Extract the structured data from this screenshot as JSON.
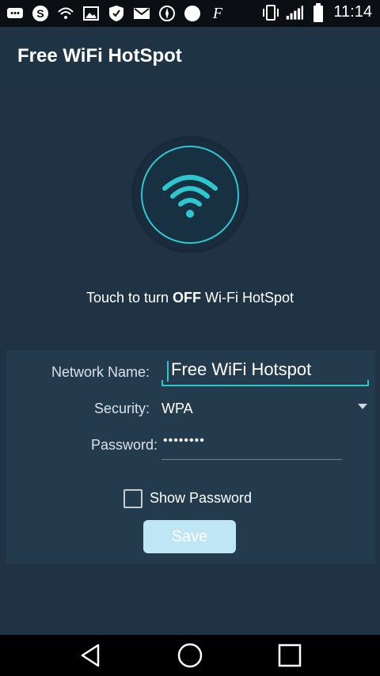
{
  "status_bar": {
    "time": "11:14",
    "icons": [
      "chat-icon",
      "skype-icon",
      "wifi-hotspot-icon",
      "image-icon",
      "shield-icon",
      "mail-icon",
      "compass-icon",
      "circle-icon",
      "f-letter-icon",
      "vibrate-icon",
      "signal-icon",
      "battery-icon"
    ],
    "f_glyph": "F"
  },
  "app_bar": {
    "title": "Free WiFi HotSpot"
  },
  "hotspot": {
    "instruction_prefix": "Touch to turn ",
    "instruction_state": "OFF",
    "instruction_suffix": " Wi-Fi HotSpot",
    "accent_color": "#2ec7cf"
  },
  "form": {
    "network_name_label": "Network Name:",
    "network_name_value": "Free WiFi Hotspot",
    "security_label": "Security:",
    "security_value": "WPA",
    "password_label": "Password:",
    "password_value": "••••••••",
    "show_password_label": "Show Password",
    "save_label": "Save"
  },
  "nav_bar": {
    "buttons": [
      "back-icon",
      "home-icon",
      "recents-icon"
    ]
  }
}
